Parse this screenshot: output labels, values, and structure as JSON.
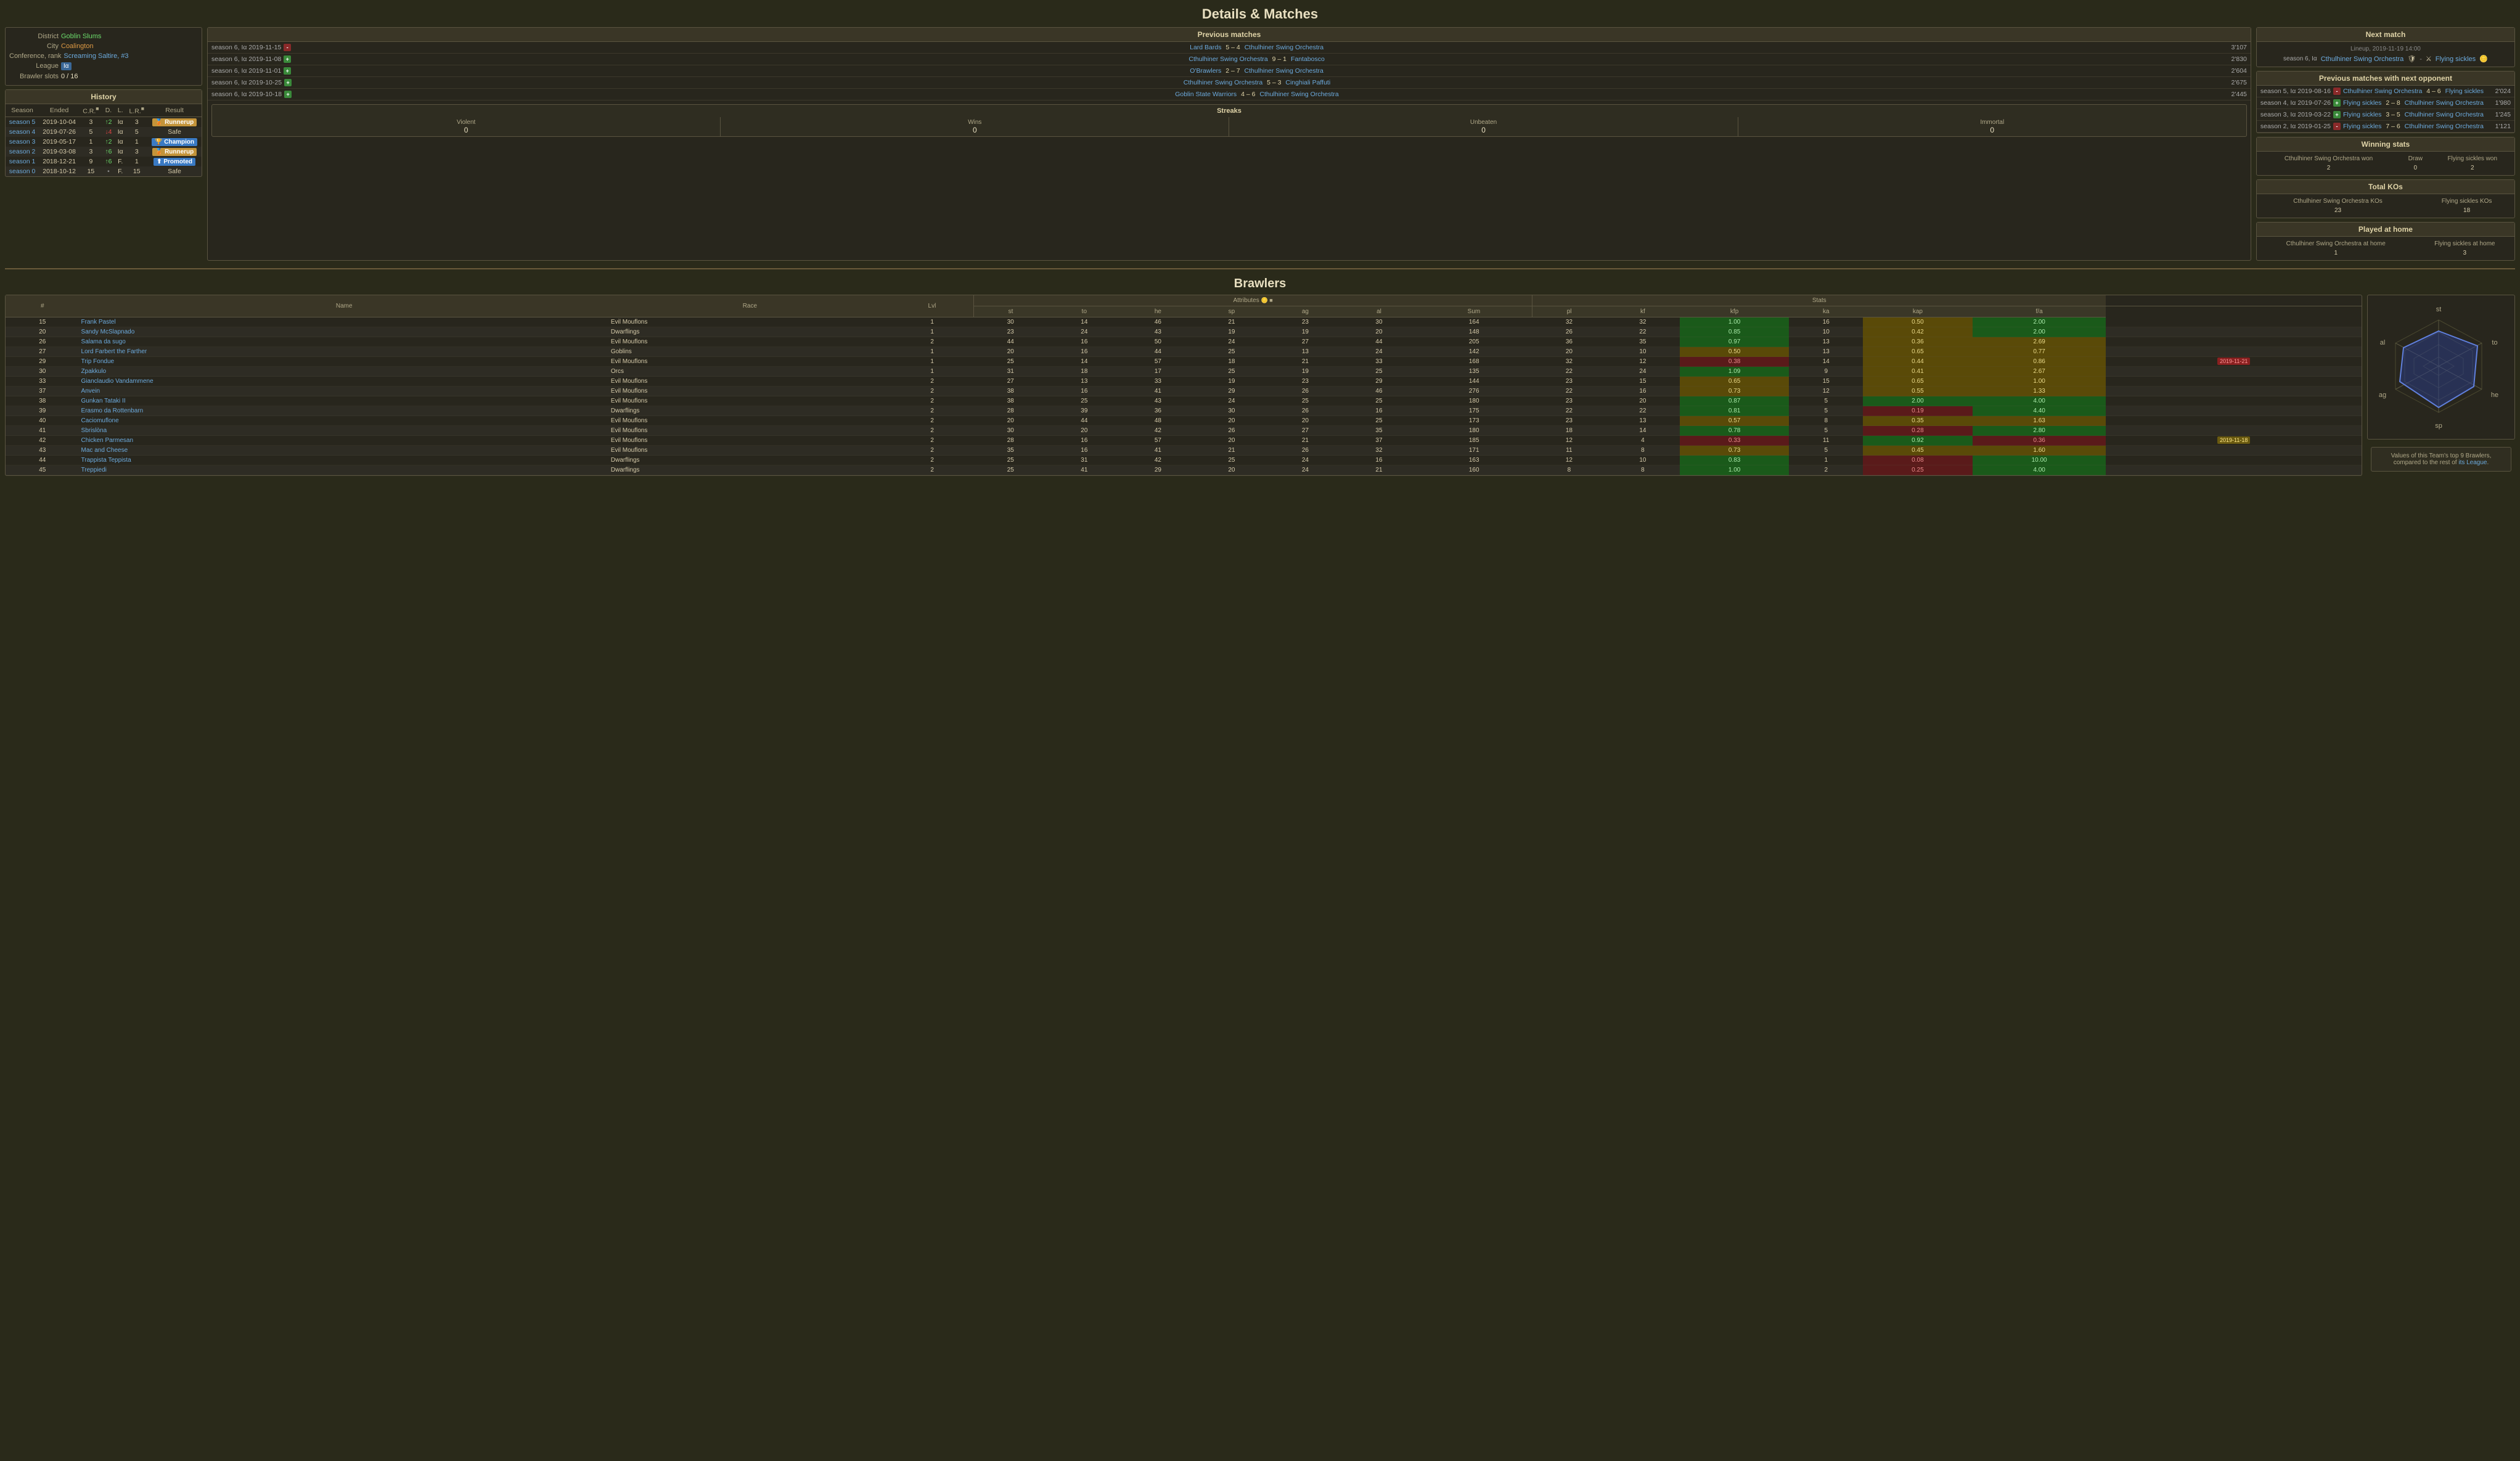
{
  "page": {
    "title": "Details & Matches",
    "brawlers_title": "Brawlers"
  },
  "team_info": {
    "district_label": "District",
    "district_value": "Goblin Slums",
    "city_label": "City",
    "city_value": "Coalington",
    "conference_label": "Conference, rank",
    "conference_value": "Screaming Saltire, #3",
    "league_label": "League",
    "league_value": "Iα",
    "brawler_slots_label": "Brawler slots",
    "brawler_slots_value": "0 / 16"
  },
  "history": {
    "title": "History",
    "col_headers": [
      "Season",
      "Ended",
      "C.R.",
      "D.",
      "L.",
      "L.R.",
      "Result"
    ],
    "rows": [
      {
        "season": "season 5",
        "ended": "2019-10-04",
        "cr": "3",
        "d": "↑2",
        "l": "Iα",
        "lr": "3",
        "result": "Runnerup",
        "result_type": "runnerup"
      },
      {
        "season": "season 4",
        "ended": "2019-07-26",
        "cr": "5",
        "d": "↓4",
        "l": "Iα",
        "lr": "5",
        "result": "Safe",
        "result_type": "safe"
      },
      {
        "season": "season 3",
        "ended": "2019-05-17",
        "cr": "1",
        "d": "↑2",
        "l": "Iα",
        "lr": "1",
        "result": "Champion",
        "result_type": "champion"
      },
      {
        "season": "season 2",
        "ended": "2019-03-08",
        "cr": "3",
        "d": "↑6",
        "l": "Iα",
        "lr": "3",
        "result": "Runnerup",
        "result_type": "runnerup"
      },
      {
        "season": "season 1",
        "ended": "2018-12-21",
        "cr": "9",
        "d": "↑6",
        "l": "F.",
        "lr": "1",
        "result": "Promoted",
        "result_type": "promoted"
      },
      {
        "season": "season 0",
        "ended": "2018-10-12",
        "cr": "15",
        "d": "•",
        "l": "F.",
        "lr": "15",
        "result": "Safe",
        "result_type": "safe"
      }
    ]
  },
  "previous_matches": {
    "title": "Previous matches",
    "matches": [
      {
        "season": "season 6, Iα 2019-11-15",
        "result": "-",
        "result_type": "loss",
        "home": "Lard Bards",
        "home_score": "5",
        "away_score": "4",
        "away": "Cthulhiner Swing Orchestra",
        "time": "3'107"
      },
      {
        "season": "season 6, Iα 2019-11-08",
        "result": "+",
        "result_type": "win",
        "home": "Cthulhiner Swing Orchestra",
        "home_score": "9",
        "away_score": "1",
        "away": "Fantabosco",
        "time": "2'830"
      },
      {
        "season": "season 6, Iα 2019-11-01",
        "result": "+",
        "result_type": "win",
        "home": "O'Brawlers",
        "home_score": "2",
        "away_score": "7",
        "away": "Cthulhiner Swing Orchestra",
        "time": "2'604"
      },
      {
        "season": "season 6, Iα 2019-10-25",
        "result": "+",
        "result_type": "win",
        "home": "Cthulhiner Swing Orchestra",
        "home_score": "5",
        "away_score": "3",
        "away": "Cinghiali Paffuti",
        "time": "2'675"
      },
      {
        "season": "season 6, Iα 2019-10-18",
        "result": "+",
        "result_type": "win",
        "home": "Goblin State Warriors",
        "home_score": "4",
        "away_score": "6",
        "away": "Cthulhiner Swing Orchestra",
        "time": "2'445"
      }
    ],
    "streaks": {
      "title": "Streaks",
      "cols": [
        "Violent",
        "Wins",
        "Unbeaten",
        "Immortal"
      ],
      "values": [
        "0",
        "0",
        "0",
        "0"
      ]
    }
  },
  "next_match": {
    "title": "Next match",
    "lineup": "Lineup, 2019-11-19 14:00",
    "home_team": "Cthulhiner Swing Orchestra",
    "away_team": "Flying sickles",
    "season_info": "season 6, Iα"
  },
  "prev_matches_opponent": {
    "title": "Previous matches with next opponent",
    "matches": [
      {
        "season": "season 5, Iα 2019-08-16",
        "result": "-",
        "result_type": "loss",
        "home": "Cthulhiner Swing Orchestra",
        "home_score": "4",
        "away_score": "6",
        "away": "Flying sickles",
        "time": "2'024"
      },
      {
        "season": "season 4, Iα 2019-07-26",
        "result": "+",
        "result_type": "win",
        "home": "Flying sickles",
        "home_score": "2",
        "away_score": "8",
        "away": "Cthulhiner Swing Orchestra",
        "time": "1'980"
      },
      {
        "season": "season 3, Iα 2019-03-22",
        "result": "+",
        "result_type": "win",
        "home": "Flying sickles",
        "home_score": "3",
        "away_score": "5",
        "away": "Cthulhiner Swing Orchestra",
        "time": "1'245"
      },
      {
        "season": "season 2, Iα 2019-01-25",
        "result": "-",
        "result_type": "loss",
        "home": "Flying sickles",
        "home_score": "7",
        "away_score": "6",
        "away": "Cthulhiner Swing Orchestra",
        "time": "1'121"
      }
    ]
  },
  "winning_stats": {
    "title": "Winning stats",
    "home_name": "Cthulhiner Swing Orchestra won",
    "home_value": "2",
    "draw_label": "Draw",
    "draw_value": "0",
    "away_name": "Flying sickles won",
    "away_value": "2"
  },
  "total_kos": {
    "title": "Total KOs",
    "home_label": "Cthulhiner Swing Orchestra KOs",
    "home_value": "23",
    "away_label": "Flying sickles KOs",
    "away_value": "18"
  },
  "played_at_home": {
    "title": "Played at home",
    "home_label": "Cthulhiner Swing Orchestra at home",
    "home_value": "1",
    "away_label": "Flying sickles at home",
    "away_value": "3"
  },
  "brawlers": {
    "col_headers_left": [
      "#",
      "Name",
      "Race",
      "Lvl"
    ],
    "col_headers_attr": [
      "st",
      "to",
      "he",
      "sp",
      "ag",
      "al",
      "Sum"
    ],
    "col_headers_stats": [
      "pl",
      "kf",
      "kfp",
      "ka",
      "kap",
      "f/a"
    ],
    "rows": [
      {
        "num": 15,
        "name": "Frank Pastel",
        "race": "Evil Mouflons",
        "lvl": 1,
        "st": 30,
        "to": 14,
        "he": 46,
        "sp": 21,
        "ag": 23,
        "al": 30,
        "sum": 164,
        "sum_color": "",
        "pl": 32,
        "kf": 32,
        "kfp": "1.00",
        "ka": 16,
        "kap": "0.50",
        "fa": "2.00",
        "kfp_color": "green",
        "kap_color": "yellow",
        "fa_color": "green",
        "badge": null
      },
      {
        "num": 20,
        "name": "Sandy McSlapnado",
        "race": "Dwarflings",
        "lvl": 1,
        "st": 23,
        "to": 24,
        "he": 43,
        "sp": 19,
        "ag": 19,
        "al": 20,
        "sum": 148,
        "pl": 26,
        "kf": 22,
        "kfp": "0.85",
        "ka": 10,
        "kap": "0.42",
        "fa": "2.00",
        "kfp_color": "green",
        "kap_color": "yellow",
        "fa_color": "green",
        "badge": null
      },
      {
        "num": 26,
        "name": "Salama da sugo",
        "race": "Evil Mouflons",
        "lvl": 2,
        "st": 44,
        "to": 16,
        "he": 50,
        "sp": 24,
        "ag": 27,
        "al": 44,
        "sum": 205,
        "pl": 36,
        "kf": 35,
        "kfp": "0.97",
        "ka": 13,
        "kap": "0.36",
        "fa": "2.69",
        "kfp_color": "green",
        "kap_color": "yellow",
        "fa_color": "yellow",
        "badge": null
      },
      {
        "num": 27,
        "name": "Lord Farbert the Farther",
        "race": "Goblins",
        "lvl": 1,
        "st": 20,
        "to": 16,
        "he": 44,
        "sp": 25,
        "ag": 13,
        "al": 24,
        "sum": 142,
        "pl": 20,
        "kf": 10,
        "kfp": "0.50",
        "ka": 13,
        "kap": "0.65",
        "fa": "0.77",
        "kfp_color": "yellow",
        "kap_color": "yellow",
        "fa_color": "yellow",
        "badge": null
      },
      {
        "num": 29,
        "name": "Trip Fondue",
        "race": "Evil Mouflons",
        "lvl": 1,
        "st": 25,
        "to": 14,
        "he": 57,
        "sp": 18,
        "ag": 21,
        "al": 33,
        "sum": 168,
        "pl": 32,
        "kf": 12,
        "kfp": "0.38",
        "ka": 14,
        "kap": "0.44",
        "fa": "0.86",
        "kfp_color": "red",
        "kap_color": "yellow",
        "fa_color": "yellow",
        "badge": "2019-11-21",
        "badge_color": "red"
      },
      {
        "num": 30,
        "name": "Zpakkulo",
        "race": "Orcs",
        "lvl": 1,
        "st": 31,
        "to": 18,
        "he": 17,
        "sp": 25,
        "ag": 19,
        "al": 25,
        "sum": 135,
        "pl": 22,
        "kf": 24,
        "kfp": "1.09",
        "ka": 9,
        "kap": "0.41",
        "fa": "2.67",
        "kfp_color": "green",
        "kap_color": "yellow",
        "fa_color": "yellow",
        "badge": null
      },
      {
        "num": 33,
        "name": "Gianclaudio Vandammene",
        "race": "Evil Mouflons",
        "lvl": 2,
        "st": 27,
        "to": 13,
        "he": 33,
        "sp": 19,
        "ag": 23,
        "al": 29,
        "sum": 144,
        "pl": 23,
        "kf": 15,
        "kfp": "0.65",
        "ka": 15,
        "kap": "0.65",
        "fa": "1.00",
        "kfp_color": "yellow",
        "kap_color": "yellow",
        "fa_color": "yellow",
        "badge": null
      },
      {
        "num": 37,
        "name": "Anvein",
        "race": "Evil Mouflons",
        "lvl": 2,
        "st": 38,
        "to": 16,
        "he": 41,
        "sp": 29,
        "ag": 26,
        "al": 46,
        "sum": 276,
        "pl": 22,
        "kf": 16,
        "kfp": "0.73",
        "ka": 12,
        "kap": "0.55",
        "fa": "1.33",
        "kfp_color": "yellow",
        "kap_color": "yellow",
        "fa_color": "yellow",
        "badge": null
      },
      {
        "num": 38,
        "name": "Gunkan Tataki II",
        "race": "Evil Mouflons",
        "lvl": 2,
        "st": 38,
        "to": 25,
        "he": 43,
        "sp": 24,
        "ag": 25,
        "al": 25,
        "sum": 180,
        "pl": 23,
        "kf": 20,
        "kfp": "0.87",
        "ka": 5,
        "kap": "2.00",
        "fa": "4.00",
        "kfp_color": "green",
        "kap_color": "green",
        "fa_color": "green",
        "badge": null
      },
      {
        "num": 39,
        "name": "Erasmo da Rottenbarn",
        "race": "Dwarflings",
        "lvl": 2,
        "st": 28,
        "to": 39,
        "he": 36,
        "sp": 30,
        "ag": 26,
        "al": 16,
        "sum": 175,
        "pl": 22,
        "kf": 22,
        "kfp": "0.81",
        "ka": 5,
        "kap": "0.19",
        "fa": "4.40",
        "kfp_color": "green",
        "kap_color": "red",
        "fa_color": "green",
        "badge": null
      },
      {
        "num": 40,
        "name": "Caciomuflone",
        "race": "Evil Mouflons",
        "lvl": 2,
        "st": 20,
        "to": 44,
        "he": 48,
        "sp": 20,
        "ag": 20,
        "al": 25,
        "sum": 173,
        "pl": 23,
        "kf": 13,
        "kfp": "0.57",
        "ka": 8,
        "kap": "0.35",
        "fa": "1.63",
        "kfp_color": "yellow",
        "kap_color": "yellow",
        "fa_color": "yellow",
        "badge": null
      },
      {
        "num": 41,
        "name": "Sbrislòna",
        "race": "Evil Mouflons",
        "lvl": 2,
        "st": 30,
        "to": 20,
        "he": 42,
        "sp": 26,
        "ag": 27,
        "al": 35,
        "sum": 180,
        "pl": 18,
        "kf": 14,
        "kfp": "0.78",
        "ka": 5,
        "kap": "0.28",
        "fa": "2.80",
        "kfp_color": "green",
        "kap_color": "red",
        "fa_color": "green",
        "badge": null
      },
      {
        "num": 42,
        "name": "Chicken Parmesan",
        "race": "Evil Mouflons",
        "lvl": 2,
        "st": 28,
        "to": 16,
        "he": 57,
        "sp": 20,
        "ag": 21,
        "al": 37,
        "sum": 185,
        "pl": 12,
        "kf": 4,
        "kfp": "0.33",
        "ka": 11,
        "kap": "0.92",
        "fa": "0.36",
        "kfp_color": "red",
        "kap_color": "green",
        "fa_color": "red",
        "badge": "2019-11-18",
        "badge_color": "yellow"
      },
      {
        "num": 43,
        "name": "Mac and Cheese",
        "race": "Evil Mouflons",
        "lvl": 2,
        "st": 35,
        "to": 16,
        "he": 41,
        "sp": 21,
        "ag": 26,
        "al": 32,
        "sum": 171,
        "pl": 11,
        "kf": 8,
        "kfp": "0.73",
        "ka": 5,
        "kap": "0.45",
        "fa": "1.60",
        "kfp_color": "yellow",
        "kap_color": "yellow",
        "fa_color": "yellow",
        "badge": null
      },
      {
        "num": 44,
        "name": "Trappista Teppista",
        "race": "Dwarflings",
        "lvl": 2,
        "st": 25,
        "to": 31,
        "he": 42,
        "sp": 25,
        "ag": 24,
        "al": 16,
        "sum": 163,
        "pl": 12,
        "kf": 10,
        "kfp": "0.83",
        "ka": 1,
        "kap": "0.08",
        "fa": "10.00",
        "kfp_color": "green",
        "kap_color": "red",
        "fa_color": "green",
        "badge": null
      },
      {
        "num": 45,
        "name": "Treppiedi",
        "race": "Dwarflings",
        "lvl": 2,
        "st": 25,
        "to": 41,
        "he": 29,
        "sp": 20,
        "ag": 24,
        "al": 21,
        "sum": 160,
        "pl": 8,
        "kf": 8,
        "kfp": "1.00",
        "ka": 2,
        "kap": "0.25",
        "fa": "4.00",
        "kfp_color": "green",
        "kap_color": "red",
        "fa_color": "green",
        "badge": null
      }
    ]
  },
  "radar_chart": {
    "note": "Values of this Team's top 9 Brawlers,",
    "note2": "compared to the rest of its League.",
    "league_text": "its League",
    "axes": [
      "st",
      "to",
      "he",
      "sp",
      "ag",
      "al"
    ]
  }
}
